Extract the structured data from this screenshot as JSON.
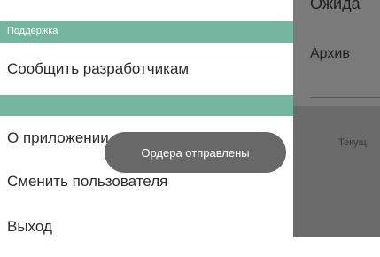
{
  "drawer": {
    "section_title": "Поддержка",
    "items": [
      {
        "label": "Сообщить разработчикам"
      },
      {
        "label": "О приложении"
      },
      {
        "label": "Сменить пользователя"
      },
      {
        "label": "Выход"
      }
    ]
  },
  "background": {
    "top_text": "Ожида",
    "archive_text": "Архив",
    "current_text": "Текущ"
  },
  "toast": {
    "message": "Ордера отправлены"
  },
  "colors": {
    "accent": "#76b6a1",
    "toast_bg": "#686868",
    "scrim": "#6b6b6b"
  }
}
